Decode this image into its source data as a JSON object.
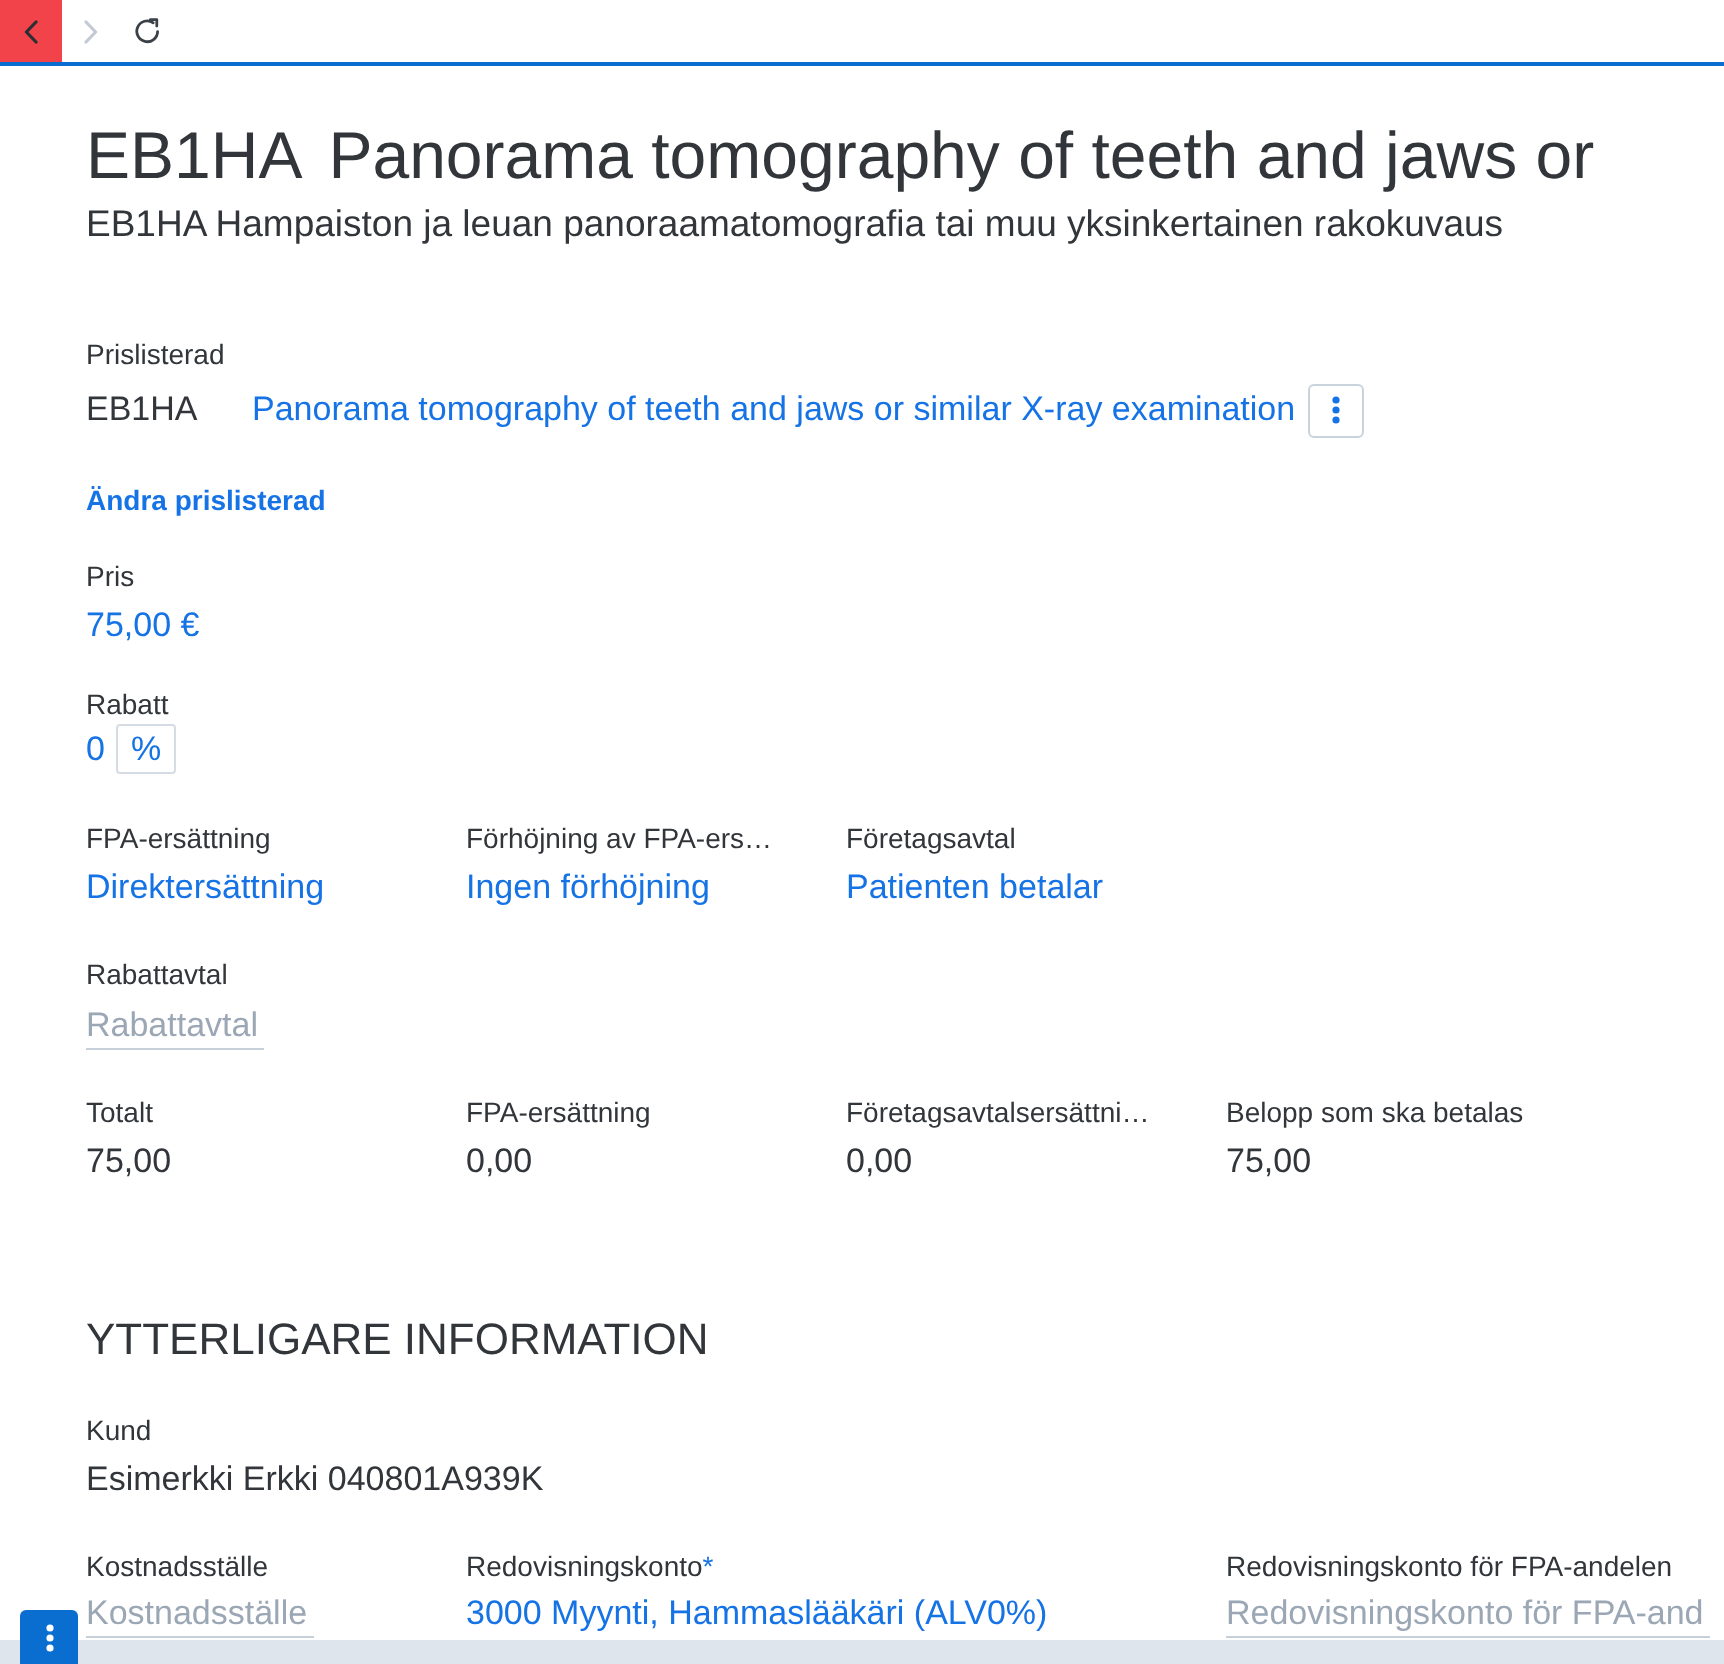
{
  "toolbar": {
    "buttons": [
      {
        "kind": "back",
        "highlighted": true,
        "disabled": false
      },
      {
        "kind": "forward",
        "highlighted": false,
        "disabled": true
      },
      {
        "kind": "reload",
        "highlighted": false,
        "disabled": false
      }
    ]
  },
  "header": {
    "code": "EB1HA",
    "title": "Panorama tomography of teeth and jaws or",
    "subtitle": "EB1HA Hampaiston ja leuan panoraamatomografia tai muu yksinkertainen rakokuvaus"
  },
  "price_list_item": {
    "label": "Prislisterad",
    "code": "EB1HA",
    "name": "Panorama tomography of teeth and jaws or similar X-ray examination",
    "change_link": "Ändra prislisterad"
  },
  "price": {
    "label": "Pris",
    "kind": "link",
    "value": "75,00 €"
  },
  "discount": {
    "label": "Rabatt",
    "value": "0",
    "unit": "%"
  },
  "reimbursement_fields": [
    {
      "label": "FPA-ersättning",
      "kind": "link",
      "value": "Direktersättning"
    },
    {
      "label": "Förhöjning av FPA-ers…",
      "kind": "link",
      "value": "Ingen förhöjning"
    },
    {
      "label": "Företagsavtal",
      "kind": "link",
      "value": "Patienten betalar"
    }
  ],
  "discount_agreement": {
    "label": "Rabattavtal",
    "kind": "input",
    "placeholder": "Rabattavtal"
  },
  "totals": [
    {
      "label": "Totalt",
      "kind": "text",
      "value": "75,00"
    },
    {
      "label": "FPA-ersättning",
      "kind": "text",
      "value": "0,00"
    },
    {
      "label": "Företagsavtalsersättni…",
      "kind": "text",
      "value": "0,00"
    },
    {
      "label": "Belopp som ska betalas",
      "kind": "text",
      "value": "75,00"
    }
  ],
  "additional_info": {
    "heading": "YTTERLIGARE INFORMATION",
    "customer": {
      "label": "Kund",
      "kind": "text",
      "value": "Esimerkki Erkki 040801A939K"
    },
    "accounting_fields": [
      {
        "label": "Kostnadsställe",
        "kind": "input",
        "placeholder": "Kostnadsställe"
      },
      {
        "label": "Redovisningskonto",
        "required_mark": "*",
        "kind": "link",
        "value": "3000 Myynti, Hammaslääkäri (ALV0%)"
      },
      {
        "label": "Redovisningskonto för FPA-andelen",
        "kind": "input",
        "placeholder": "Redovisningskonto för FPA-and"
      }
    ]
  }
}
